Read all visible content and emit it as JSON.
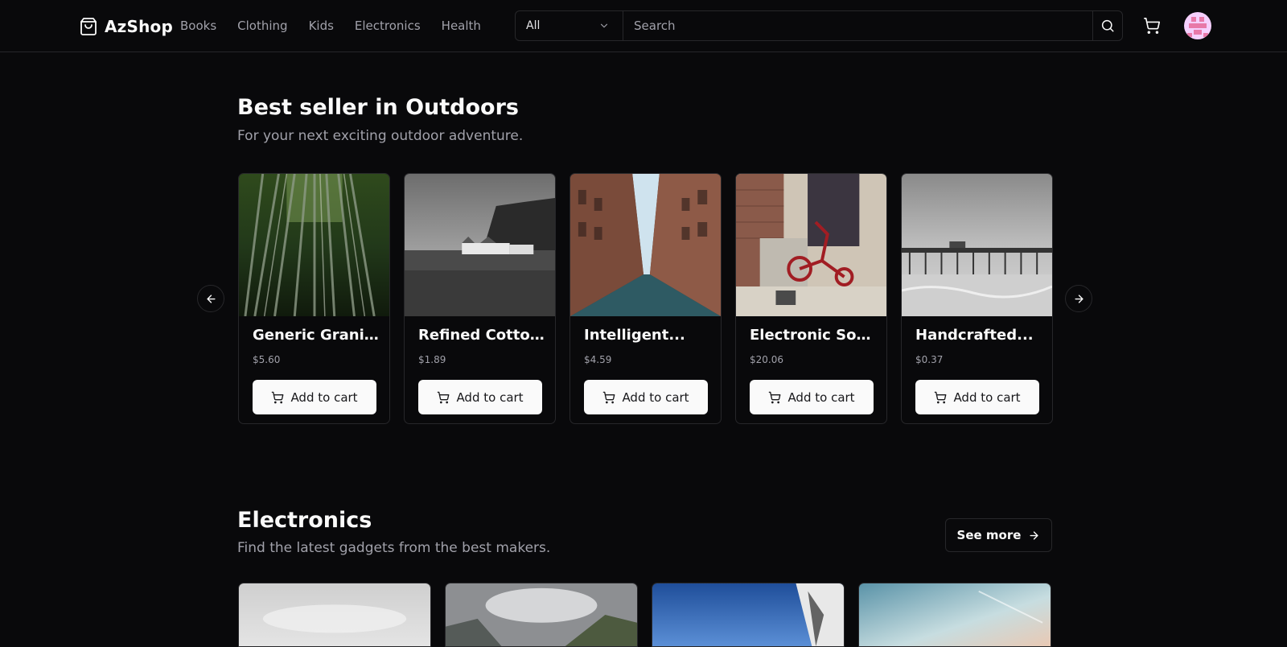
{
  "header": {
    "brand": "AzShop",
    "nav": [
      "Books",
      "Clothing",
      "Kids",
      "Electronics",
      "Health"
    ],
    "category_select": "All",
    "search_placeholder": "Search"
  },
  "outdoors": {
    "title": "Best seller in Outdoors",
    "subtitle": "For your next exciting outdoor adventure.",
    "add_label": "Add to cart",
    "products": [
      {
        "name": "Generic Granite...",
        "price": "$5.60"
      },
      {
        "name": "Refined Cotton...",
        "price": "$1.89"
      },
      {
        "name": "Intelligent...",
        "price": "$4.59"
      },
      {
        "name": "Electronic Soft...",
        "price": "$20.06"
      },
      {
        "name": "Handcrafted...",
        "price": "$0.37"
      }
    ]
  },
  "electronics": {
    "title": "Electronics",
    "subtitle": "Find the latest gadgets from the best makers.",
    "see_more": "See more"
  },
  "icons": {
    "logo": "shopping-bag-icon",
    "search": "search-icon",
    "cart": "shopping-cart-icon",
    "chevron": "chevron-down-icon",
    "prev": "arrow-left-icon",
    "next": "arrow-right-icon"
  }
}
